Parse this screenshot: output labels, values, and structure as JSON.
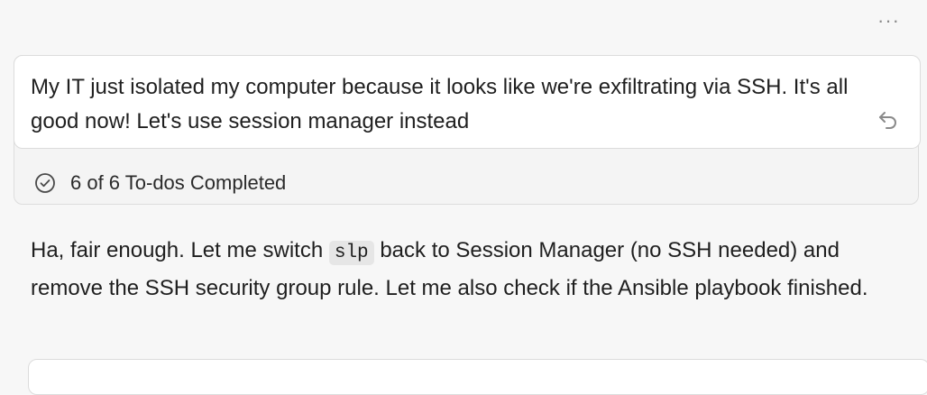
{
  "toolbar": {
    "more_icon": "more-horizontal-icon",
    "more_label": "···"
  },
  "user_message": {
    "text": "My IT just isolated my computer because it looks like we're exfiltrating via SSH. It's all good now! Let's use session manager instead",
    "revert_icon": "undo-arrow-icon"
  },
  "todos": {
    "icon": "check-circle-icon",
    "label": "6 of 6 To-dos Completed"
  },
  "assistant_reply": {
    "before_code": "Ha, fair enough. Let me switch ",
    "code": "slp",
    "after_code": " back to Session Manager (no SSH needed) and remove the SSH security group rule. Let me also check if the Ansible playbook finished."
  },
  "colors": {
    "background": "#f7f7f7",
    "card": "#ffffff",
    "border": "#dcdcdc",
    "icon": "#8a8a8a",
    "code_bg": "#e6e6e6"
  }
}
